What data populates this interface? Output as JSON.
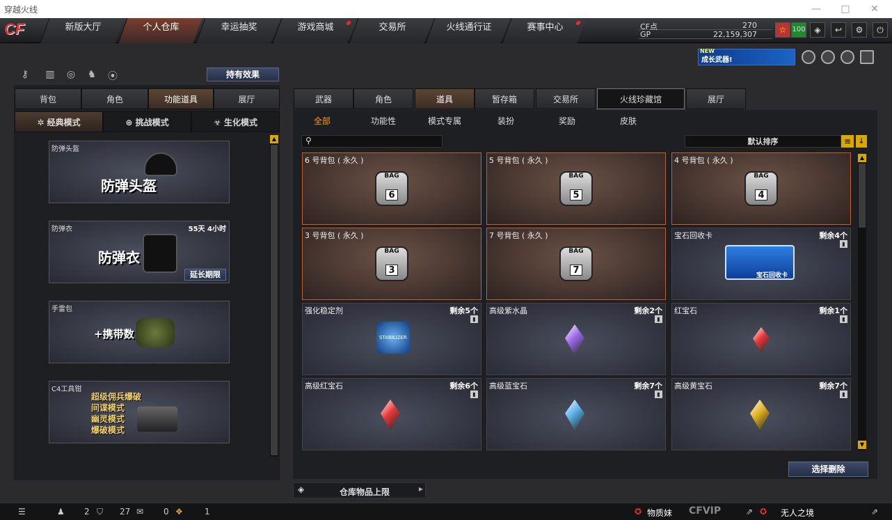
{
  "window": {
    "title": "穿越火线",
    "min": "—",
    "max": "□",
    "close": "✕"
  },
  "nav": {
    "logo": "CF",
    "tabs": [
      "新版大厅",
      "个人仓库",
      "幸运抽奖",
      "游戏商城",
      "交易所",
      "火线通行证",
      "赛事中心"
    ]
  },
  "currency": {
    "cf_label": "CF点",
    "cf_value": "270",
    "gp_label": "GP",
    "gp_value": "22,159,307"
  },
  "status": {
    "level": "100",
    "rank_icon": "rank-badge-icon"
  },
  "banner": {
    "new": "NEW",
    "text": "成长武器!"
  },
  "left": {
    "effects_button": "持有效果",
    "tabs": [
      "背包",
      "角色",
      "功能道具",
      "展厅"
    ],
    "modes": [
      "经典模式",
      "挑战模式",
      "生化模式"
    ],
    "cards": [
      {
        "label": "防弹头盔",
        "big": "防弹头盔",
        "time": "",
        "extend": ""
      },
      {
        "label": "防弹衣",
        "big": "防弹衣",
        "time": "55天 4小时",
        "extend": "延长期限"
      },
      {
        "label": "手雷包",
        "big": "+携带数",
        "time": "",
        "extend": ""
      },
      {
        "label": "C4工具钳",
        "lines": [
          "超级佣兵爆破",
          "间谍模式",
          "幽灵模式",
          "爆破模式"
        ]
      }
    ]
  },
  "right": {
    "tabs": [
      "武器",
      "角色",
      "道具",
      "暂存箱",
      "交易所",
      "火线珍藏馆",
      "展厅"
    ],
    "subtabs": [
      "全部",
      "功能性",
      "模式专属",
      "装扮",
      "奖励",
      "皮肤"
    ],
    "sort_label": "默认排序",
    "items": [
      {
        "name": "6 号背包 ( 永久 )",
        "count": "",
        "bag": "6",
        "bag_label": "BAG"
      },
      {
        "name": "5 号背包 ( 永久 )",
        "count": "",
        "bag": "5",
        "bag_label": "BAG"
      },
      {
        "name": "4 号背包 ( 永久 )",
        "count": "",
        "bag": "4",
        "bag_label": "BAG"
      },
      {
        "name": "3 号背包 ( 永久 )",
        "count": "",
        "bag": "3",
        "bag_label": "BAG"
      },
      {
        "name": "7 号背包 ( 永久 )",
        "count": "",
        "bag": "7",
        "bag_label": "BAG"
      },
      {
        "name": "宝石回收卡",
        "count": "剩余4个",
        "card_text": "宝石回收卡"
      },
      {
        "name": "强化稳定剂",
        "count": "剩余5个",
        "jar_text": "STABILIZER"
      },
      {
        "name": "高级紫水晶",
        "count": "剩余2个",
        "gem_color": "#9b6ae8"
      },
      {
        "name": "红宝石",
        "count": "剩余1个",
        "gem_color": "#e8383a"
      },
      {
        "name": "高级红宝石",
        "count": "剩余6个",
        "gem_color": "#e8383a"
      },
      {
        "name": "高级蓝宝石",
        "count": "剩余7个",
        "gem_color": "#5ab0e8"
      },
      {
        "name": "高级黄宝石",
        "count": "剩余7个",
        "gem_color": "#e0b020"
      }
    ],
    "delete_button": "选择删除",
    "storage_label": "仓库物品上限"
  },
  "bottom": {
    "counts": [
      "2",
      "27",
      "0",
      "1"
    ],
    "player": "物质妹",
    "vip": "CFVIP",
    "mode": "无人之境"
  }
}
